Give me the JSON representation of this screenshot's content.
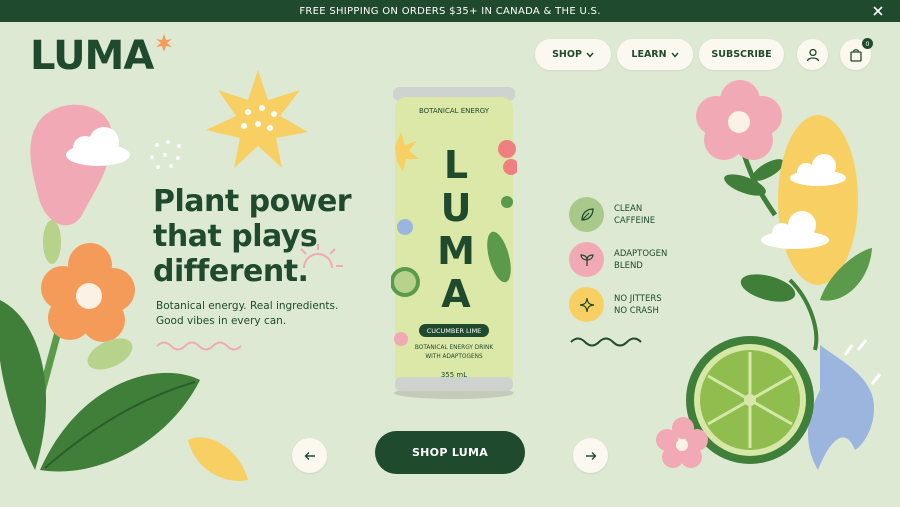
{
  "announcement": {
    "text": "FREE SHIPPING ON ORDERS $35+ IN CANADA & THE U.S.",
    "close_icon": "close-icon"
  },
  "brand": {
    "logo": "LUMA"
  },
  "nav": {
    "shop": "SHOP",
    "learn": "LEARN",
    "subscribe": "SUBSCRIBE",
    "account_icon": "user-icon",
    "cart_icon": "bag-icon",
    "cart_count": "0"
  },
  "hero": {
    "headline_lines": [
      "Plant power",
      "that plays",
      "different."
    ],
    "sub_lines": [
      "Botanical energy. Real ingredients.",
      "Good vibes in every can."
    ]
  },
  "can": {
    "top_label": "BOTANICAL ENERGY",
    "brand": "LUMA",
    "flavor": "CUCUMBER LIME",
    "desc_lines": [
      "BOTANICAL ENERGY DRINK",
      "WITH ADAPTOGENS"
    ],
    "volume": "355 mL"
  },
  "features": [
    {
      "lines": [
        "CLEAN",
        "CAFFEINE"
      ],
      "icon": "leaf-icon",
      "color": "#a9c98a"
    },
    {
      "lines": [
        "ADAPTOGEN",
        "BLEND"
      ],
      "icon": "sprout-icon",
      "color": "#f2a9b6"
    },
    {
      "lines": [
        "NO JITTERS",
        "NO CRASH"
      ],
      "icon": "sparkle-icon",
      "color": "#f8cf63"
    }
  ],
  "cta": {
    "shop_label": "SHOP LUMA",
    "prev_icon": "arrow-left-icon",
    "next_icon": "arrow-right-icon"
  },
  "colors": {
    "dark_green": "#1f4a2d",
    "background": "#dde9d3",
    "pill": "#fbf8f0",
    "pink": "#f2a9b6",
    "yellow": "#f8cf63",
    "orange": "#f59b5a",
    "leaf": "#5a9a4a",
    "blue": "#9bb5df"
  }
}
